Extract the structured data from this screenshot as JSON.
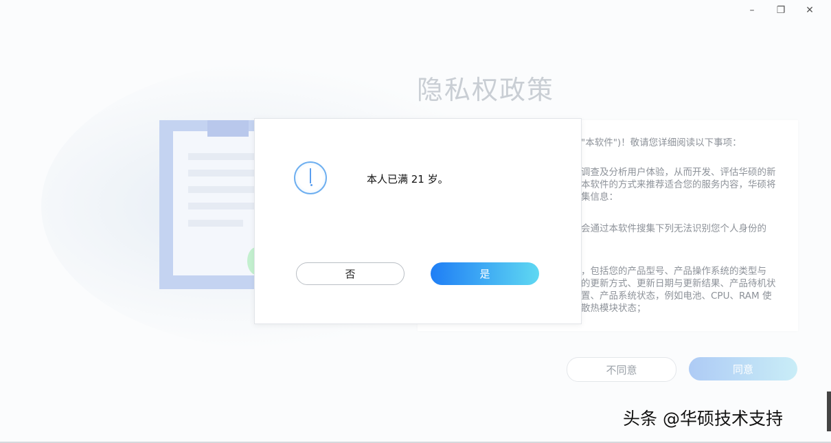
{
  "window": {
    "minimize_glyph": "–",
    "restore_glyph": "❐",
    "close_glyph": "✕"
  },
  "page": {
    "title": "隐私权政策"
  },
  "policy": {
    "lines": [
      "\"本软件\")！敬请您详细阅读以下事项：",
      "调查及分析用户体验，从而开发、评估华硕的新\n本软件的方式来推荐适合您的服务内容，华硕将\n集信息：",
      "会通过本软件搜集下列无法识别您个人身份的",
      "，包括您的产品型号、产品操作系统的类型与\n的更新方式、更新日期与更新结果、产品待机状\n置、产品系统状态，例如电池、CPU、RAM 使\n散热模块状态；"
    ],
    "disagree_label": "不同意",
    "agree_label": "同意"
  },
  "dialog": {
    "icon": "info-exclamation-icon",
    "message": "本人已满 21 岁。",
    "no_label": "否",
    "yes_label": "是"
  },
  "watermark": {
    "text": "头条 @华硕技术支持"
  },
  "colors": {
    "primary_gradient_start": "#1f7ef5",
    "primary_gradient_end": "#5fd8f2",
    "title_gray": "#c9ced4"
  }
}
